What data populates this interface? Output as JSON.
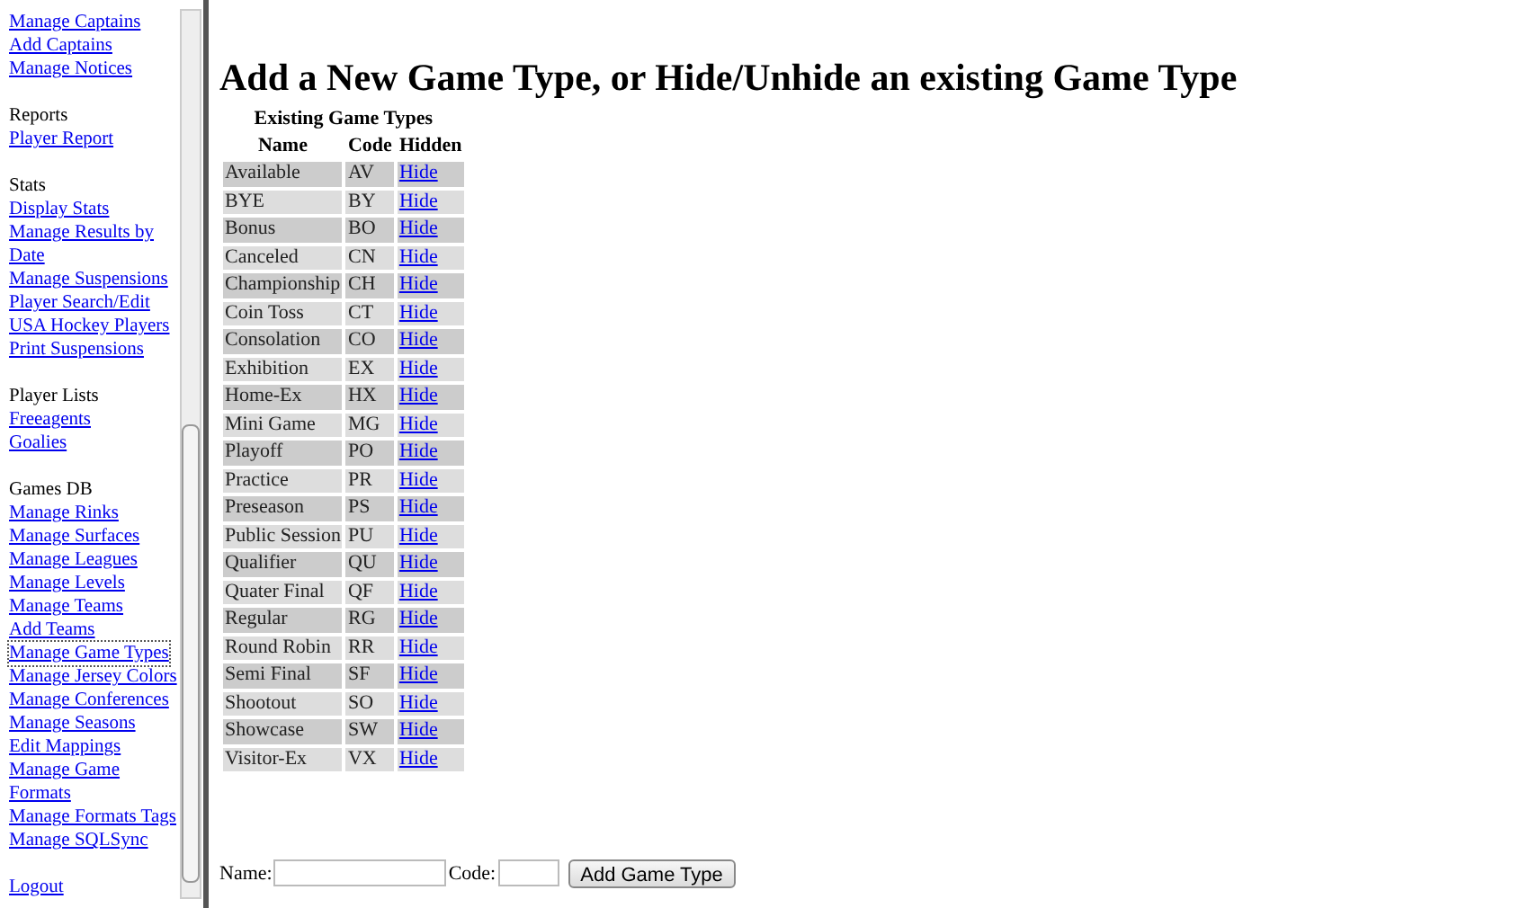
{
  "sidebar": {
    "sections": [
      {
        "items": [
          {
            "label": "Manage Captains",
            "selected": false
          },
          {
            "label": "Add Captains",
            "selected": false
          },
          {
            "label": "Manage Notices",
            "selected": false
          }
        ]
      },
      {
        "title": "Reports",
        "items": [
          {
            "label": "Player Report",
            "selected": false
          }
        ]
      },
      {
        "title": "Stats",
        "items": [
          {
            "label": "Display Stats",
            "selected": false
          },
          {
            "label": "Manage Results by Date",
            "selected": false
          },
          {
            "label": "Manage Suspensions",
            "selected": false
          },
          {
            "label": "Player Search/Edit",
            "selected": false
          },
          {
            "label": "USA Hockey Players",
            "selected": false
          },
          {
            "label": "Print Suspensions",
            "selected": false
          }
        ]
      },
      {
        "title": "Player Lists",
        "items": [
          {
            "label": "Freeagents",
            "selected": false
          },
          {
            "label": "Goalies",
            "selected": false
          }
        ]
      },
      {
        "title": "Games DB",
        "items": [
          {
            "label": "Manage Rinks",
            "selected": false
          },
          {
            "label": "Manage Surfaces",
            "selected": false
          },
          {
            "label": "Manage Leagues",
            "selected": false
          },
          {
            "label": "Manage Levels",
            "selected": false
          },
          {
            "label": "Manage Teams",
            "selected": false
          },
          {
            "label": "Add Teams",
            "selected": false
          },
          {
            "label": "Manage Game Types",
            "selected": true
          },
          {
            "label": "Manage Jersey Colors",
            "selected": false
          },
          {
            "label": "Manage Conferences",
            "selected": false
          },
          {
            "label": "Manage Seasons",
            "selected": false
          },
          {
            "label": "Edit Mappings",
            "selected": false
          },
          {
            "label": "Manage Game Formats",
            "selected": false
          },
          {
            "label": "Manage Formats Tags",
            "selected": false
          },
          {
            "label": "Manage SQLSync",
            "selected": false
          }
        ]
      },
      {
        "items": [
          {
            "label": "Logout",
            "selected": false
          }
        ]
      }
    ]
  },
  "heading": "Add a New Game Type, or Hide/Unhide an existing Game Type",
  "table": {
    "caption": "Existing Game Types",
    "columns": [
      "Name",
      "Code",
      "Hidden"
    ],
    "rows": [
      {
        "name": "Available",
        "code": "AV",
        "action": "Hide"
      },
      {
        "name": "BYE",
        "code": "BY",
        "action": "Hide"
      },
      {
        "name": "Bonus",
        "code": "BO",
        "action": "Hide"
      },
      {
        "name": "Canceled",
        "code": "CN",
        "action": "Hide"
      },
      {
        "name": "Championship",
        "code": "CH",
        "action": "Hide"
      },
      {
        "name": "Coin Toss",
        "code": "CT",
        "action": "Hide"
      },
      {
        "name": "Consolation",
        "code": "CO",
        "action": "Hide"
      },
      {
        "name": "Exhibition",
        "code": "EX",
        "action": "Hide"
      },
      {
        "name": "Home-Ex",
        "code": "HX",
        "action": "Hide"
      },
      {
        "name": "Mini Game",
        "code": "MG",
        "action": "Hide"
      },
      {
        "name": "Playoff",
        "code": "PO",
        "action": "Hide"
      },
      {
        "name": "Practice",
        "code": "PR",
        "action": "Hide"
      },
      {
        "name": "Preseason",
        "code": "PS",
        "action": "Hide"
      },
      {
        "name": "Public Session",
        "code": "PU",
        "action": "Hide"
      },
      {
        "name": "Qualifier",
        "code": "QU",
        "action": "Hide"
      },
      {
        "name": "Quater Final",
        "code": "QF",
        "action": "Hide"
      },
      {
        "name": "Regular",
        "code": "RG",
        "action": "Hide"
      },
      {
        "name": "Round Robin",
        "code": "RR",
        "action": "Hide"
      },
      {
        "name": "Semi Final",
        "code": "SF",
        "action": "Hide"
      },
      {
        "name": "Shootout",
        "code": "SO",
        "action": "Hide"
      },
      {
        "name": "Showcase",
        "code": "SW",
        "action": "Hide"
      },
      {
        "name": "Visitor-Ex",
        "code": "VX",
        "action": "Hide"
      }
    ]
  },
  "form": {
    "name_label": "Name:",
    "code_label": "Code:",
    "button": "Add Game Type"
  }
}
